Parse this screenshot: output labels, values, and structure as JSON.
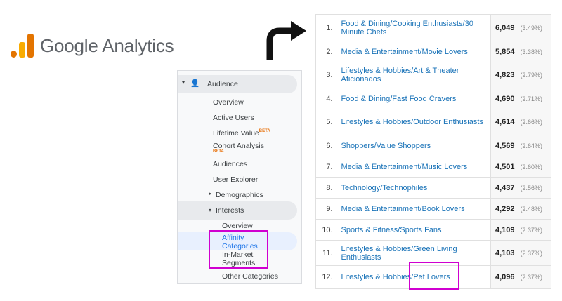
{
  "logo": {
    "text": "Google Analytics",
    "colors": [
      "#f9ab00",
      "#e37400"
    ]
  },
  "sidebar": {
    "section": "Audience",
    "items": [
      {
        "label": "Overview"
      },
      {
        "label": "Active Users"
      },
      {
        "label": "Lifetime Value",
        "badge": "BETA"
      },
      {
        "label": "Cohort Analysis",
        "badge": "BETA"
      },
      {
        "label": "Audiences"
      },
      {
        "label": "User Explorer"
      },
      {
        "label": "Demographics"
      },
      {
        "label": "Interests"
      }
    ],
    "interests": [
      "Overview",
      "Affinity Categories",
      "In-Market Segments",
      "Other Categories"
    ]
  },
  "table": {
    "rows": [
      {
        "rank": "1.",
        "name": "Food & Dining/Cooking Enthusiasts/30 Minute Chefs",
        "users": "6,049",
        "pct": "(3.49%)"
      },
      {
        "rank": "2.",
        "name": "Media & Entertainment/Movie Lovers",
        "users": "5,854",
        "pct": "(3.38%)"
      },
      {
        "rank": "3.",
        "name": "Lifestyles & Hobbies/Art & Theater Aficionados",
        "users": "4,823",
        "pct": "(2.79%)"
      },
      {
        "rank": "4.",
        "name": "Food & Dining/Fast Food Cravers",
        "users": "4,690",
        "pct": "(2.71%)"
      },
      {
        "rank": "5.",
        "name": "Lifestyles & Hobbies/Outdoor Enthusiasts",
        "users": "4,614",
        "pct": "(2.66%)"
      },
      {
        "rank": "6.",
        "name": "Shoppers/Value Shoppers",
        "users": "4,569",
        "pct": "(2.64%)"
      },
      {
        "rank": "7.",
        "name": "Media & Entertainment/Music Lovers",
        "users": "4,501",
        "pct": "(2.60%)"
      },
      {
        "rank": "8.",
        "name": "Technology/Technophiles",
        "users": "4,437",
        "pct": "(2.56%)"
      },
      {
        "rank": "9.",
        "name": "Media & Entertainment/Book Lovers",
        "users": "4,292",
        "pct": "(2.48%)"
      },
      {
        "rank": "10.",
        "name": "Sports & Fitness/Sports Fans",
        "users": "4,109",
        "pct": "(2.37%)"
      },
      {
        "rank": "11.",
        "name": "Lifestyles & Hobbies/Green Living Enthusiasts",
        "users": "4,103",
        "pct": "(2.37%)"
      },
      {
        "rank": "12.",
        "name": "Lifestyles & Hobbies/Pet Lovers",
        "users": "4,096",
        "pct": "(2.37%)"
      }
    ]
  },
  "highlight_color": "#d000d0"
}
